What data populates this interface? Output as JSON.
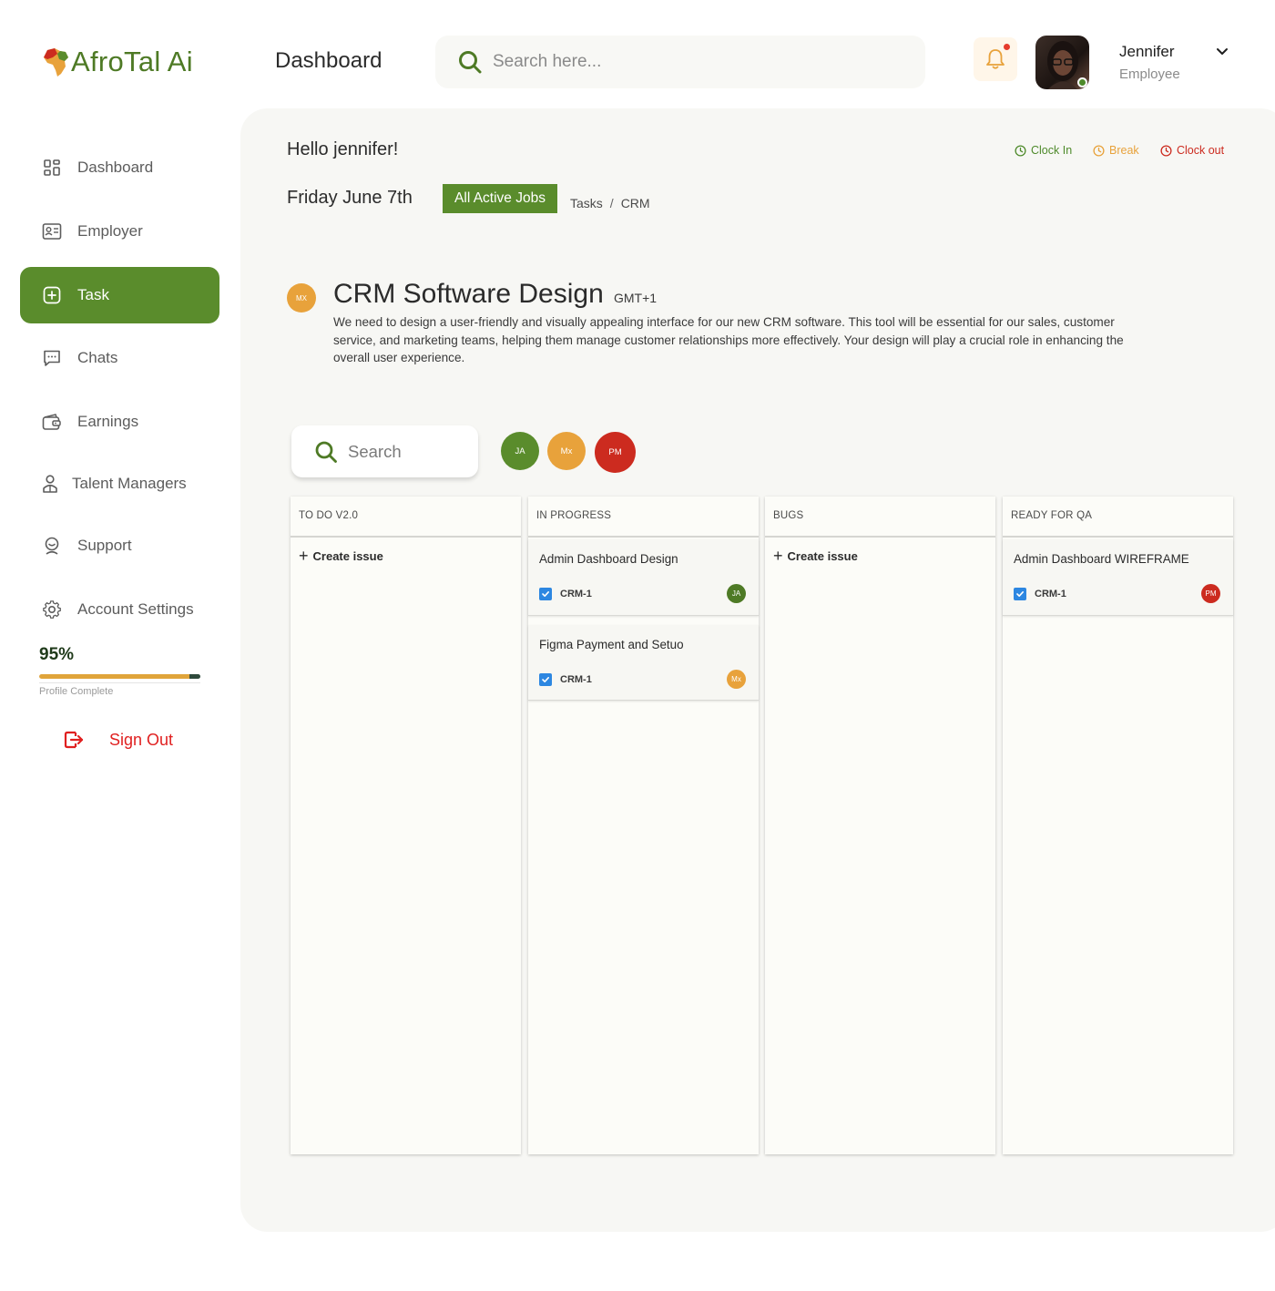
{
  "app": {
    "brand": "AfroTal Ai",
    "header_title": "Dashboard",
    "search_placeholder": "Search here...",
    "user": {
      "name": "Jennifer",
      "role": "Employee"
    }
  },
  "sidebar": {
    "items": [
      {
        "label": "Dashboard",
        "icon": "grid-icon",
        "active": false
      },
      {
        "label": "Employer",
        "icon": "id-card-icon",
        "active": false
      },
      {
        "label": "Task",
        "icon": "plus-square-icon",
        "active": true
      },
      {
        "label": "Chats",
        "icon": "chat-icon",
        "active": false
      },
      {
        "label": "Earnings",
        "icon": "wallet-icon",
        "active": false
      },
      {
        "label": "Talent Managers",
        "icon": "manager-icon",
        "active": false
      },
      {
        "label": "Support",
        "icon": "support-icon",
        "active": false
      },
      {
        "label": "Account Settings",
        "icon": "gear-icon",
        "active": false
      }
    ],
    "profile_progress": {
      "value": 0.95,
      "text": "95%",
      "label": "Profile Complete"
    },
    "sign_out": "Sign Out"
  },
  "main": {
    "greeting": "Hello jennifer!",
    "clock": {
      "in": "Clock In",
      "break": "Break",
      "out": "Clock out"
    },
    "date": "Friday June 7th",
    "jobs_button": "All Active Jobs",
    "breadcrumb": [
      "Tasks",
      "CRM"
    ],
    "breadcrumb_sep": "/",
    "project": {
      "badge": "MX",
      "title": "CRM Software Design",
      "timezone": "GMT+1",
      "description": "We need to design a user-friendly and visually appealing interface for our new CRM software. This tool will be essential for our sales, customer service, and marketing teams, helping them manage customer relationships more effectively. Your design will play a crucial role in enhancing the overall user experience."
    },
    "board_search": "Search",
    "members": [
      "JA",
      "Mx",
      "PM"
    ]
  },
  "board": {
    "create_issue": "Create issue",
    "columns": [
      {
        "title": "TO DO V2.0",
        "cards": []
      },
      {
        "title": "IN PROGRESS",
        "cards": [
          {
            "title": "Admin Dashboard Design",
            "key": "CRM-1",
            "assignee": "JA"
          },
          {
            "title": "Figma Payment and Setuo",
            "key": "CRM-1",
            "assignee": "Mx"
          }
        ]
      },
      {
        "title": "BUGS",
        "cards": []
      },
      {
        "title": "READY FOR QA",
        "cards": [
          {
            "title": "Admin Dashboard WIREFRAME",
            "key": "CRM-1",
            "assignee": "PM"
          }
        ]
      }
    ]
  },
  "colors": {
    "brand_green": "#5a8c2c",
    "orange": "#e8a23b",
    "red": "#cc2b1f",
    "sign_out_red": "#e02020",
    "clock_in": "#4e8a2a",
    "break": "#e8a23b",
    "clock_out": "#cc2b1f"
  }
}
